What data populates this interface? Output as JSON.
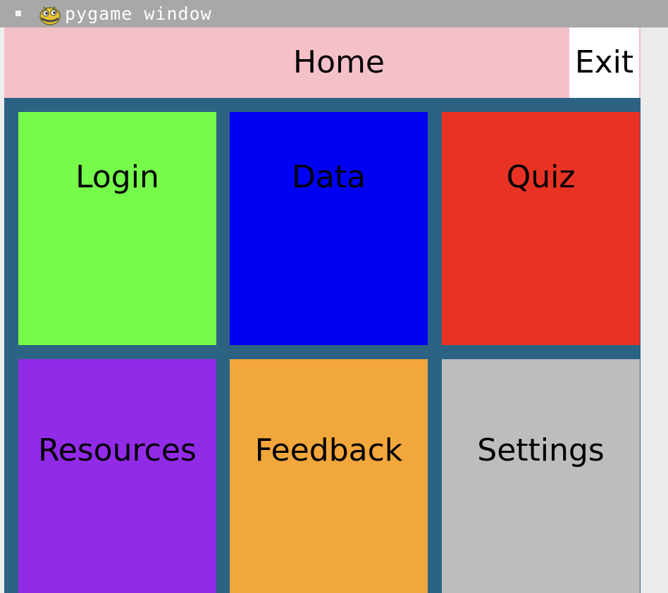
{
  "titlebar": {
    "title": "pygame window",
    "icon": "pygame-snake-icon"
  },
  "header": {
    "title": "Home",
    "exit_label": "Exit",
    "background_color": "#f5c1c9"
  },
  "tiles": [
    {
      "label": "Login",
      "color": "#76fb4b"
    },
    {
      "label": "Data",
      "color": "#0000f5"
    },
    {
      "label": "Quiz",
      "color": "#e83324"
    },
    {
      "label": "Resources",
      "color": "#922be8"
    },
    {
      "label": "Feedback",
      "color": "#f1a73c"
    },
    {
      "label": "Settings",
      "color": "#bdbdbd"
    }
  ],
  "colors": {
    "window_background": "#2c6383",
    "titlebar_background": "#a8a8a8"
  }
}
